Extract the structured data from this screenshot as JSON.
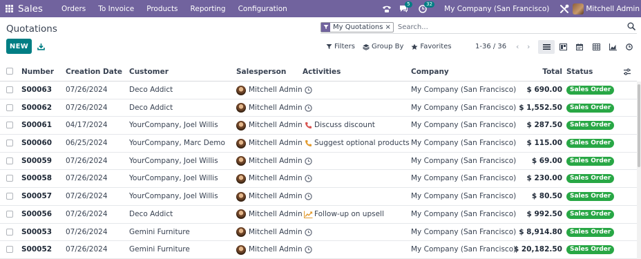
{
  "navbar": {
    "app_name": "Sales",
    "menu": [
      "Orders",
      "To Invoice",
      "Products",
      "Reporting",
      "Configuration"
    ],
    "messages_count": "5",
    "activities_count": "32",
    "company": "My Company (San Francisco)",
    "user": "Mitchell Admin"
  },
  "page": {
    "title": "Quotations",
    "new_label": "NEW"
  },
  "search": {
    "facet": "My Quotations",
    "facet_remove": "×",
    "placeholder": "Search..."
  },
  "filters": {
    "filters_label": "Filters",
    "group_by_label": "Group By",
    "favorites_label": "Favorites"
  },
  "pager": {
    "value": "1-36 / 36",
    "prev": "‹",
    "next": "›"
  },
  "table": {
    "headers": {
      "number": "Number",
      "creation_date": "Creation Date",
      "customer": "Customer",
      "salesperson": "Salesperson",
      "activities": "Activities",
      "company": "Company",
      "total": "Total",
      "status": "Status"
    },
    "rows": [
      {
        "number": "S00063",
        "date": "07/26/2024",
        "customer": "Deco Addict",
        "salesperson": "Mitchell Admin",
        "activity_icon": "clock-icon",
        "activity": "",
        "company": "My Company (San Francisco)",
        "total": "$ 690.00",
        "status": "Sales Order"
      },
      {
        "number": "S00062",
        "date": "07/26/2024",
        "customer": "Deco Addict",
        "salesperson": "Mitchell Admin",
        "activity_icon": "clock-icon",
        "activity": "",
        "company": "My Company (San Francisco)",
        "total": "$ 1,552.50",
        "status": "Sales Order"
      },
      {
        "number": "S00061",
        "date": "04/17/2024",
        "customer": "YourCompany, Joel Willis",
        "salesperson": "Mitchell Admin",
        "activity_icon": "phone-icon-red",
        "activity": "Discuss discount",
        "company": "My Company (San Francisco)",
        "total": "$ 287.50",
        "status": "Sales Order"
      },
      {
        "number": "S00060",
        "date": "06/25/2024",
        "customer": "YourCompany, Marc Demo",
        "salesperson": "Mitchell Admin",
        "activity_icon": "phone-icon-orange",
        "activity": "Suggest optional products",
        "company": "My Company (San Francisco)",
        "total": "$ 115.00",
        "status": "Sales Order"
      },
      {
        "number": "S00059",
        "date": "07/26/2024",
        "customer": "YourCompany, Joel Willis",
        "salesperson": "Mitchell Admin",
        "activity_icon": "clock-icon",
        "activity": "",
        "company": "My Company (San Francisco)",
        "total": "$ 69.00",
        "status": "Sales Order"
      },
      {
        "number": "S00058",
        "date": "07/26/2024",
        "customer": "YourCompany, Joel Willis",
        "salesperson": "Mitchell Admin",
        "activity_icon": "clock-icon",
        "activity": "",
        "company": "My Company (San Francisco)",
        "total": "$ 230.00",
        "status": "Sales Order"
      },
      {
        "number": "S00057",
        "date": "07/26/2024",
        "customer": "YourCompany, Joel Willis",
        "salesperson": "Mitchell Admin",
        "activity_icon": "clock-icon",
        "activity": "",
        "company": "My Company (San Francisco)",
        "total": "$ 80.50",
        "status": "Sales Order"
      },
      {
        "number": "S00056",
        "date": "07/26/2024",
        "customer": "Deco Addict",
        "salesperson": "Mitchell Admin",
        "activity_icon": "trend-up-icon",
        "activity": "Follow-up on upsell",
        "company": "My Company (San Francisco)",
        "total": "$ 992.50",
        "status": "Sales Order"
      },
      {
        "number": "S00053",
        "date": "07/26/2024",
        "customer": "Gemini Furniture",
        "salesperson": "Mitchell Admin",
        "activity_icon": "clock-icon",
        "activity": "",
        "company": "My Company (San Francisco)",
        "total": "$ 8,914.80",
        "status": "Sales Order"
      },
      {
        "number": "S00052",
        "date": "07/26/2024",
        "customer": "Gemini Furniture",
        "salesperson": "Mitchell Admin",
        "activity_icon": "clock-icon",
        "activity": "",
        "company": "My Company (San Francisco)",
        "total": "$ 20,182.50",
        "status": "Sales Order"
      }
    ]
  },
  "colors": {
    "navbar": "#71639e",
    "primary": "#017e84",
    "status_green": "#28a745",
    "activity_red": "#d9534f",
    "activity_orange": "#e39b2e"
  }
}
